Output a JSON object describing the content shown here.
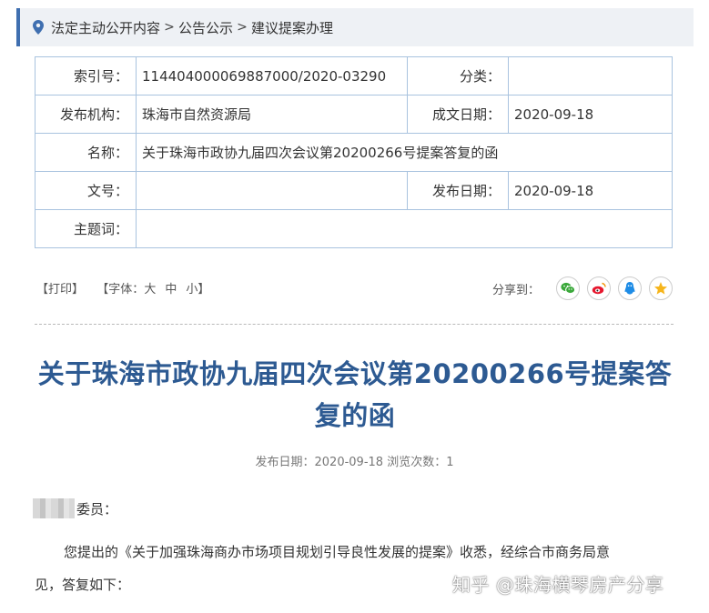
{
  "breadcrumb": {
    "items": [
      "法定主动公开内容",
      "公告公示",
      "建议提案办理"
    ],
    "separator": ">"
  },
  "info": {
    "index_label": "索引号：",
    "index_value": "114404000069887000/2020-03290",
    "category_label": "分类：",
    "category_value": "",
    "publisher_label": "发布机构：",
    "publisher_value": "珠海市自然资源局",
    "created_label": "成文日期：",
    "created_value": "2020-09-18",
    "name_label": "名称：",
    "name_value": "关于珠海市政协九届四次会议第20200266号提案答复的函",
    "docno_label": "文号：",
    "docno_value": "",
    "published_label": "发布日期：",
    "published_value": "2020-09-18",
    "keywords_label": "主题词：",
    "keywords_value": ""
  },
  "tools": {
    "print": "【打印】",
    "font_prefix": "【字体：",
    "font_large": "大",
    "font_medium": "中",
    "font_small": "小",
    "font_suffix": "】",
    "share_label": "分享到：",
    "share_icons": [
      "wechat-icon",
      "weibo-icon",
      "qq-icon",
      "qzone-star-icon"
    ]
  },
  "article": {
    "title": "关于珠海市政协九届四次会议第20200266号提案答复的函",
    "meta": "发布日期：2020-09-18  浏览次数：1",
    "salutation": "委员：",
    "line1": "您提出的《关于加强珠海商办市场项目规划引导良性发展的提案》收悉，经综合市商务局意",
    "line2": "见，答复如下："
  },
  "watermark": "知乎 @珠海横琴房产分享",
  "colors": {
    "accent": "#3f6fb0",
    "title": "#2d5a92",
    "table_border": "#a9c3df",
    "breadcrumb_bg": "#eef1f5"
  }
}
